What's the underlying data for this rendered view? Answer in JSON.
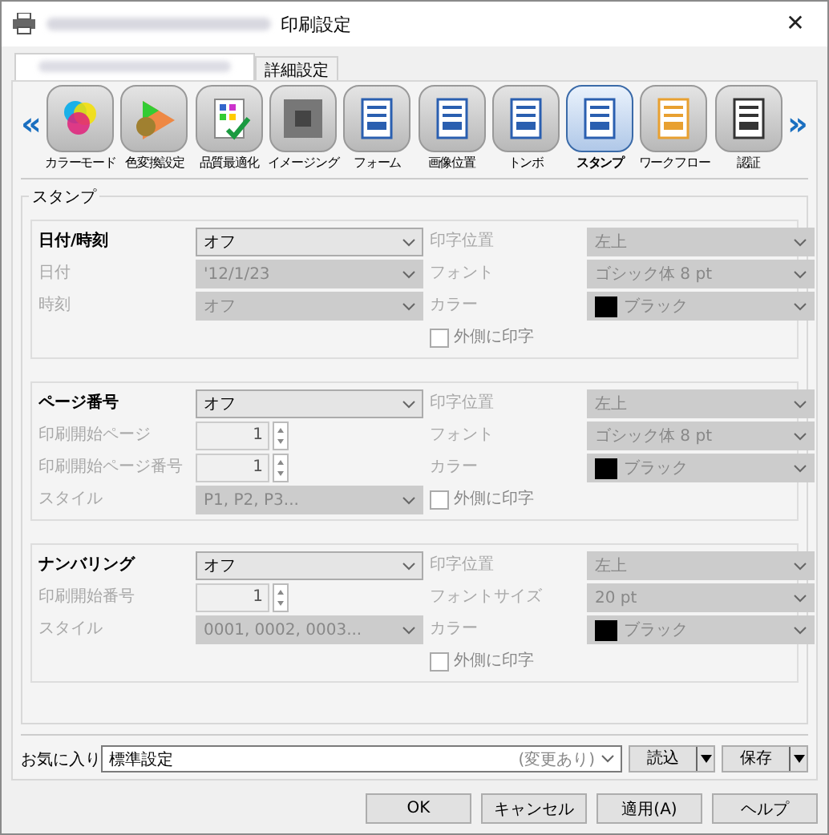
{
  "window": {
    "title": "印刷設定",
    "close": "✕"
  },
  "tabs": [
    {
      "redacted": true,
      "selected": true
    },
    {
      "label": "詳細設定",
      "selected": false
    }
  ],
  "toolbar": {
    "prev": "«",
    "next": "»",
    "items": [
      {
        "label": "カラーモード",
        "selected": false
      },
      {
        "label": "色変換設定",
        "selected": false
      },
      {
        "label": "品質最適化",
        "selected": false
      },
      {
        "label": "イメージング",
        "selected": false
      },
      {
        "label": "フォーム",
        "selected": false
      },
      {
        "label": "画像位置",
        "selected": false
      },
      {
        "label": "トンボ",
        "selected": false
      },
      {
        "label": "スタンプ",
        "selected": true
      },
      {
        "label": "ワークフロー",
        "selected": false
      },
      {
        "label": "認証",
        "selected": false
      }
    ]
  },
  "group": {
    "title": "スタンプ",
    "sections": [
      {
        "title": "日付/時刻",
        "value": "オフ",
        "left": [
          {
            "label": "日付",
            "kind": "combo",
            "value": "'12/1/23",
            "disabled": true
          },
          {
            "label": "時刻",
            "kind": "combo",
            "value": "オフ",
            "disabled": true
          }
        ],
        "right": [
          {
            "label": "印字位置",
            "kind": "combo",
            "value": "左上",
            "disabled": true
          },
          {
            "label": "フォント",
            "kind": "combo",
            "value": "ゴシック体 8 pt",
            "disabled": true
          },
          {
            "label": "カラー",
            "kind": "color",
            "value": "ブラック",
            "color": "#000000",
            "disabled": true
          }
        ],
        "outside": {
          "label": "外側に印字",
          "checked": false
        }
      },
      {
        "title": "ページ番号",
        "value": "オフ",
        "left": [
          {
            "label": "印刷開始ページ",
            "kind": "spin",
            "value": "1",
            "disabled": true
          },
          {
            "label": "印刷開始ページ番号",
            "kind": "spin",
            "value": "1",
            "disabled": true
          },
          {
            "label": "スタイル",
            "kind": "combo",
            "value": "P1, P2, P3...",
            "disabled": true
          }
        ],
        "right": [
          {
            "label": "印字位置",
            "kind": "combo",
            "value": "左上",
            "disabled": true
          },
          {
            "label": "フォント",
            "kind": "combo",
            "value": "ゴシック体 8 pt",
            "disabled": true
          },
          {
            "label": "カラー",
            "kind": "color",
            "value": "ブラック",
            "color": "#000000",
            "disabled": true
          }
        ],
        "outside": {
          "label": "外側に印字",
          "checked": false
        }
      },
      {
        "title": "ナンバリング",
        "value": "オフ",
        "left": [
          {
            "label": "印刷開始番号",
            "kind": "spin",
            "value": "1",
            "disabled": true
          },
          {
            "label": "スタイル",
            "kind": "combo",
            "value": "0001, 0002, 0003...",
            "disabled": true
          }
        ],
        "right": [
          {
            "label": "印字位置",
            "kind": "combo",
            "value": "左上",
            "disabled": true
          },
          {
            "label": "フォントサイズ",
            "kind": "combo",
            "value": "20 pt",
            "disabled": true
          },
          {
            "label": "カラー",
            "kind": "color",
            "value": "ブラック",
            "color": "#000000",
            "disabled": true
          }
        ],
        "outside": {
          "label": "外側に印字",
          "checked": false
        }
      }
    ]
  },
  "favorites": {
    "label": "お気に入り",
    "value": "標準設定",
    "note": "(変更あり)",
    "buttons": [
      "読込",
      "保存"
    ]
  },
  "buttons": [
    "OK",
    "キャンセル",
    "適用(A)",
    "ヘルプ"
  ]
}
